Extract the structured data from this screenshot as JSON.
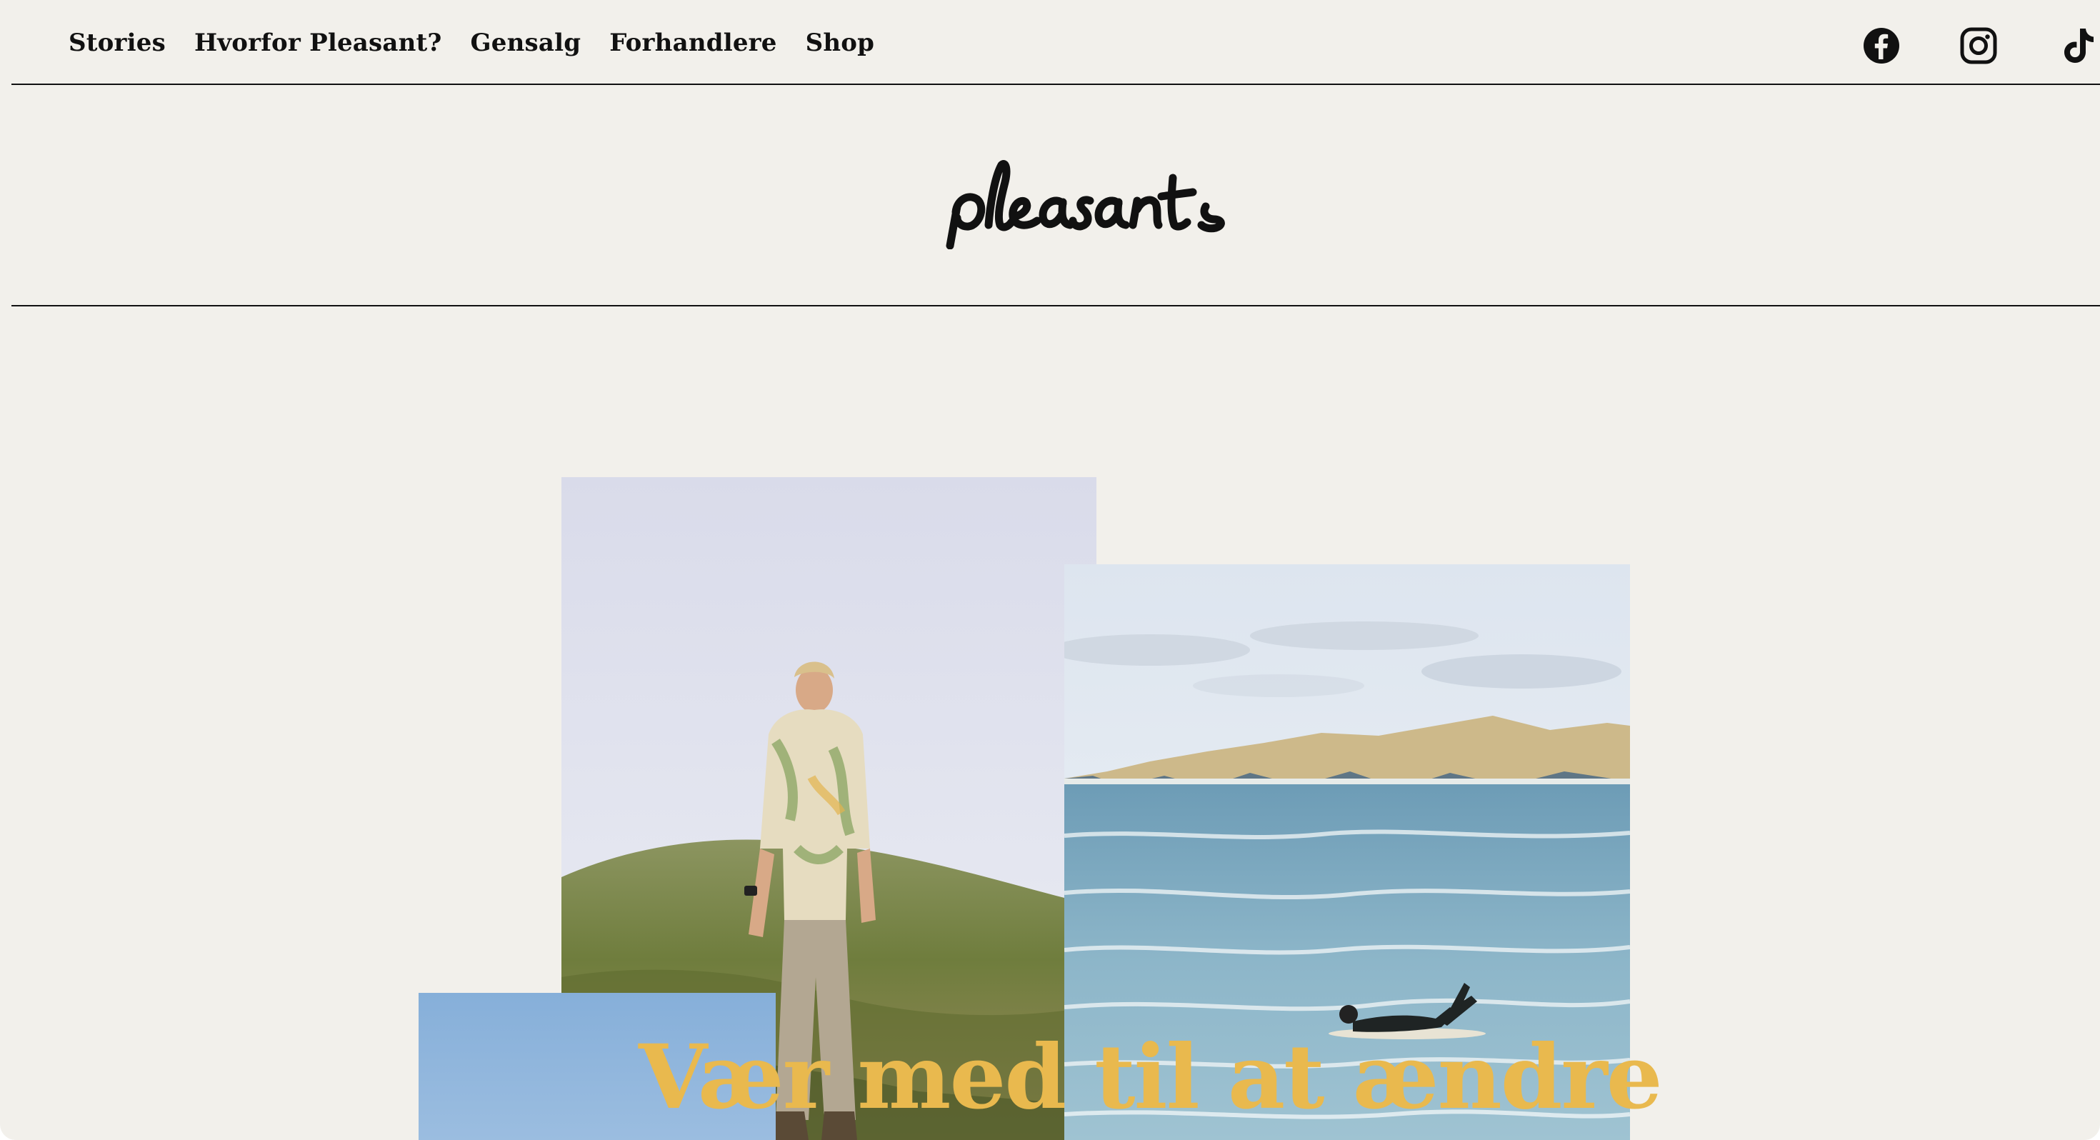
{
  "nav": {
    "items": [
      {
        "label": "Stories"
      },
      {
        "label": "Hvorfor Pleasant?"
      },
      {
        "label": "Gensalg"
      },
      {
        "label": "Forhandlere"
      },
      {
        "label": "Shop"
      }
    ]
  },
  "social": {
    "icons": [
      "facebook-icon",
      "instagram-icon",
      "tiktok-icon"
    ]
  },
  "logo": {
    "text": "pleasant",
    "color": "#111111"
  },
  "hero": {
    "headline": "Vær med til at ændre",
    "headline_color": "#e9b94e",
    "images": [
      "man-walking-dunes-photo",
      "surfer-sea-photo",
      "blue-sky-photo"
    ]
  },
  "colors": {
    "background": "#f2f0eb",
    "text": "#111111"
  }
}
